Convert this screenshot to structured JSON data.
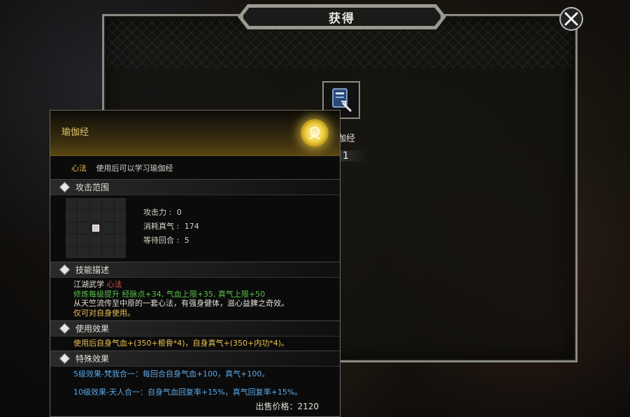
{
  "dialog": {
    "title": "获得"
  },
  "item": {
    "name_partial": "伽经",
    "count": "1"
  },
  "tooltip": {
    "name": "瑜伽经",
    "type_tag": "心法",
    "type_desc": "使用后可以学习瑜伽经",
    "sections": {
      "range": "攻击范围",
      "skill_desc": "技能描述",
      "use_effect": "使用效果",
      "special_effect": "特殊效果"
    },
    "stats": {
      "attack_label": "攻击力",
      "attack_value": "0",
      "mp_label": "消耗真气",
      "mp_value": "174",
      "wait_label": "等待回合",
      "wait_value": "5"
    },
    "desc": {
      "line1_a": "江湖武学",
      "line1_b": "心法",
      "line2": "修炼每级提升 经脉点+34, 气血上限+35, 真气上限+50",
      "line3": "从天竺流传至中原的一套心法，有强身健体，滋心益脾之奇效。",
      "line4": "仅可对自身使用。"
    },
    "use_effect_text": "使用后自身气血+(350+根骨*4)，自身真气+(350+内功*4)。",
    "special": {
      "line1": "5级效果-梵我合一：每回合自身气血+100，真气+100。",
      "line2": "10级效果-天人合一：自身气血回复率+15%，真气回复率+15%。"
    },
    "price_label": "出售价格：",
    "price_value": "2120"
  },
  "icons": {
    "close": "close-icon",
    "scroll": "scroll-icon",
    "emblem": "emblem-icon",
    "diamond": "diamond-icon"
  }
}
